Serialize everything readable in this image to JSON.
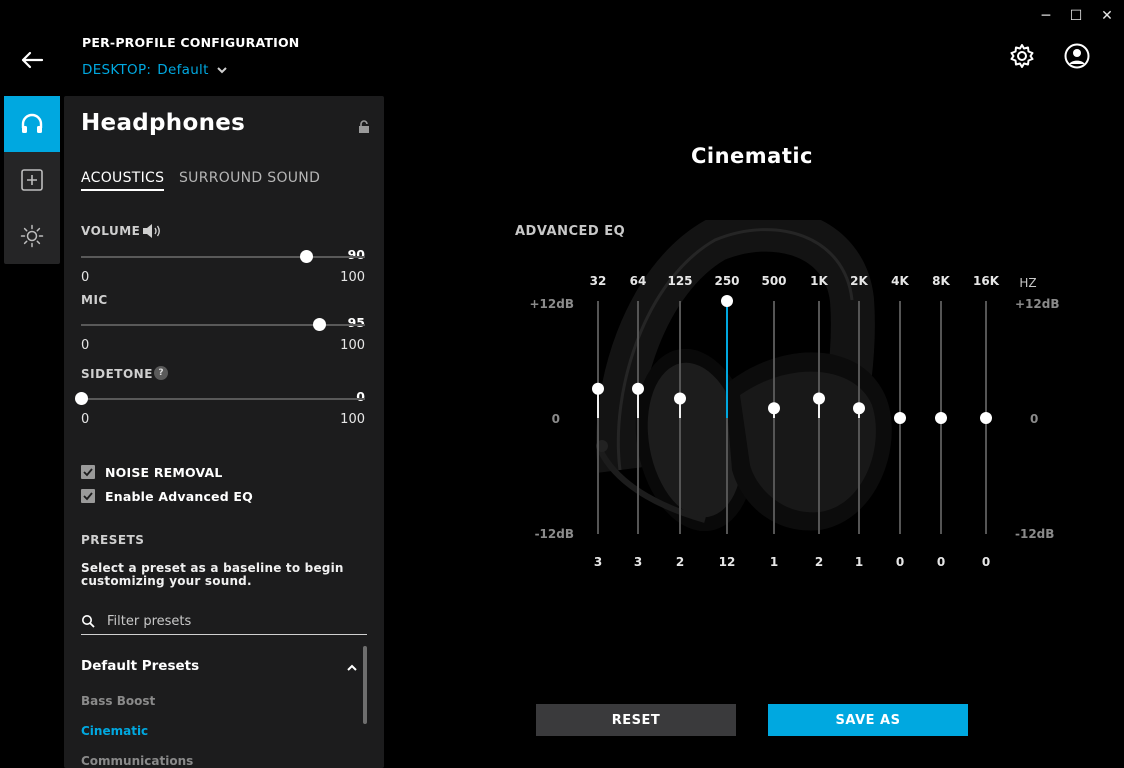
{
  "window": {
    "minimize": "─",
    "maximize": "☐",
    "close": "✕"
  },
  "header": {
    "title": "PER-PROFILE CONFIGURATION",
    "profile_prefix": "DESKTOP:",
    "profile_name": "Default"
  },
  "rail": {
    "items": [
      {
        "icon": "headphones-icon",
        "active": true
      },
      {
        "icon": "plus-square-icon",
        "active": false
      },
      {
        "icon": "lighting-icon",
        "active": false
      }
    ]
  },
  "panel": {
    "title": "Headphones",
    "tabs": [
      "ACOUSTICS",
      "SURROUND SOUND"
    ],
    "volume": {
      "label": "VOLUME",
      "value": "90",
      "min": "0",
      "max": "100",
      "level": 0.9
    },
    "mic": {
      "label": "MIC",
      "value": "95",
      "min": "0",
      "max": "100",
      "level": 0.95
    },
    "sidetone": {
      "label": "SIDETONE",
      "help": "?",
      "value": "0",
      "min": "0",
      "max": "100",
      "level": 0.0
    },
    "noise_removal": {
      "label": "NOISE REMOVAL",
      "checked": true
    },
    "advanced_eq": {
      "label": "Enable Advanced EQ",
      "checked": true
    },
    "presets_label": "PRESETS",
    "presets_desc": "Select a preset as a baseline to begin customizing your sound.",
    "search_placeholder": "Filter presets",
    "group_label": "Default Presets",
    "presets": [
      "Bass Boost",
      "Cinematic",
      "Communications"
    ],
    "selected_preset": "Cinematic"
  },
  "main": {
    "preset_title": "Cinematic",
    "eq_label": "ADVANCED EQ",
    "hz_label": "HZ",
    "db_top": "+12dB",
    "db_mid": "0",
    "db_bottom": "-12dB",
    "reset_label": "RESET",
    "save_label": "SAVE AS",
    "accent_color": "#00a8e0"
  },
  "eq": {
    "bands": [
      "32",
      "64",
      "125",
      "250",
      "500",
      "1K",
      "2K",
      "4K",
      "8K",
      "16K"
    ],
    "values": [
      3,
      3,
      2,
      12,
      1,
      2,
      1,
      0,
      0,
      0
    ],
    "value_labels": [
      "3",
      "3",
      "2",
      "12",
      "1",
      "2",
      "1",
      "0",
      "0",
      "0"
    ],
    "range": [
      -12,
      12
    ],
    "active_band": 3
  }
}
